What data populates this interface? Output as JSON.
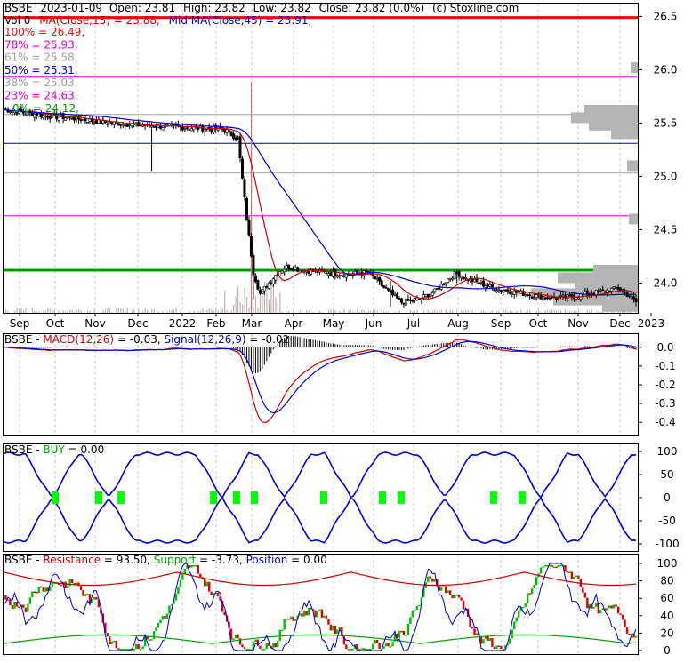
{
  "chart_data": [
    {
      "type": "candlestick",
      "panel": "price",
      "header": {
        "symbol": "BSBE",
        "date": "2023-01-09",
        "open_text": "Open: 23.81",
        "high_text": "High: 23.82",
        "low_text": "Low: 23.82",
        "close_text": "Close: 23.82 (0.0%)",
        "source": "(c) Stoxline.com",
        "vol_text": "Vol 0",
        "ma15_text": "MA(Close,15) = 23.88,",
        "ma45_text": "Mid MA(Close,45) = 23.91,"
      },
      "fib_levels": [
        {
          "label": "100% = 26.49,",
          "value": 26.49,
          "color": "#ff0000"
        },
        {
          "label": "78% = 25.93,",
          "value": 25.93,
          "color": "#e000e0"
        },
        {
          "label": "61% = 25.58,",
          "value": 25.58,
          "color": "#a0a0a0"
        },
        {
          "label": "50% = 25.31,",
          "value": 25.31,
          "color": "#0000cc"
        },
        {
          "label": "38% = 25.03,",
          "value": 25.03,
          "color": "#a0a0a0"
        },
        {
          "label": "23% = 24.63,",
          "value": 24.63,
          "color": "#e000e0"
        },
        {
          "label": "0% = 24.12,",
          "value": 24.12,
          "color": "#00a000"
        }
      ],
      "y_ticks": [
        "26.5",
        "26.0",
        "25.5",
        "25.0",
        "24.5",
        "24.0"
      ],
      "y_tick_values": [
        26.5,
        26.0,
        25.5,
        25.0,
        24.5,
        24.0
      ],
      "ylim": [
        23.72,
        26.62
      ],
      "x_ticks": [
        "Sep",
        "Oct",
        "Nov",
        "Dec",
        "2022",
        "Feb",
        "Mar",
        "Apr",
        "May",
        "Jun",
        "Jul",
        "Aug",
        "Sep",
        "Oct",
        "Nov",
        "Dec",
        "2023"
      ],
      "close_series": [
        [
          0,
          25.63
        ],
        [
          8,
          25.6
        ],
        [
          15,
          25.58
        ],
        [
          22,
          25.56
        ],
        [
          30,
          25.55
        ],
        [
          40,
          25.52
        ],
        [
          50,
          25.5
        ],
        [
          60,
          25.48
        ],
        [
          70,
          25.47
        ],
        [
          80,
          25.46
        ],
        [
          90,
          25.45
        ],
        [
          100,
          25.44
        ],
        [
          106,
          25.35
        ],
        [
          110,
          24.6
        ],
        [
          113,
          24.1
        ],
        [
          116,
          23.9
        ],
        [
          120,
          24.0
        ],
        [
          124,
          24.1
        ],
        [
          128,
          24.15
        ],
        [
          135,
          24.12
        ],
        [
          145,
          24.1
        ],
        [
          155,
          24.08
        ],
        [
          165,
          24.1
        ],
        [
          170,
          24.0
        ],
        [
          175,
          23.9
        ],
        [
          180,
          23.82
        ],
        [
          188,
          23.85
        ],
        [
          195,
          23.92
        ],
        [
          200,
          24.02
        ],
        [
          205,
          24.1
        ],
        [
          208,
          24.05
        ],
        [
          215,
          24.0
        ],
        [
          222,
          23.95
        ],
        [
          230,
          23.92
        ],
        [
          240,
          23.88
        ],
        [
          250,
          23.86
        ],
        [
          260,
          23.88
        ],
        [
          270,
          23.92
        ],
        [
          278,
          23.95
        ],
        [
          283,
          23.88
        ],
        [
          286,
          23.82
        ]
      ]
    },
    {
      "type": "line",
      "panel": "macd",
      "title_text": "BSBE - MACD(12,26) = -0.03, Signal(12,26,9) = -0.02",
      "title_parts": {
        "a": "BSBE - ",
        "b": "MACD(12,26)",
        "c": " = -0.03, ",
        "d": "Signal(12,26,9)",
        "e": " = -0.02"
      },
      "y_ticks": [
        "0.0",
        "-0.1",
        "-0.2",
        "-0.3",
        "-0.4"
      ],
      "y_tick_values": [
        0.0,
        -0.1,
        -0.2,
        -0.3,
        -0.4
      ],
      "ylim": [
        -0.47,
        0.07
      ]
    },
    {
      "type": "line",
      "panel": "buy",
      "title_text": "BSBE - BUY = 0.00",
      "title_parts": {
        "a": "BSBE - ",
        "b": "BUY",
        "c": " = 0.00"
      },
      "y_ticks": [
        "100",
        "50",
        "0",
        "-50",
        "-100"
      ],
      "y_tick_values": [
        100,
        50,
        0,
        -50,
        -100
      ]
    },
    {
      "type": "line",
      "panel": "resistance",
      "title_text": "BSBE - Resistance = 93.50, Support = -3.73, Position = 0.00",
      "title_parts": {
        "a": "BSBE - ",
        "b": "Resistance",
        "c": " = 93.50, ",
        "d": "Support",
        "e": " = -3.73, ",
        "f": "Position",
        "g": " = 0.00"
      },
      "y_ticks": [
        "100",
        "80",
        "60",
        "40",
        "20",
        "0"
      ],
      "y_tick_values": [
        100,
        80,
        60,
        40,
        20,
        0
      ]
    }
  ],
  "colors": {
    "macd": "#d00000",
    "signal": "#0000cc",
    "buy": "#00a000",
    "resistance": "#d00000",
    "support": "#00a000",
    "position": "#0000cc",
    "ma15": "#d00000",
    "ma45": "#0000cc"
  }
}
